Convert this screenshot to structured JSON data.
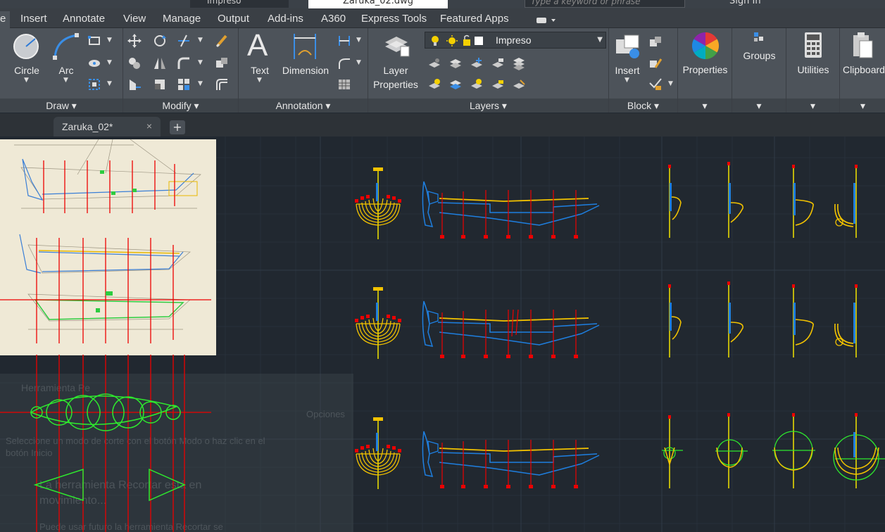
{
  "titlebar": {
    "layer_name": "Impreso",
    "document_title": "Zaruka_02.dwg",
    "search_placeholder": "Type a keyword or phrase",
    "sign_in": "Sign In"
  },
  "ribbon_tabs": [
    "e",
    "Insert",
    "Annotate",
    "View",
    "Manage",
    "Output",
    "Add-ins",
    "A360",
    "Express Tools",
    "Featured Apps"
  ],
  "ribbon": {
    "draw": {
      "circle": "Circle",
      "arc": "Arc",
      "title": "Draw"
    },
    "modify": {
      "title": "Modify"
    },
    "annotation": {
      "text": "Text",
      "dimension": "Dimension",
      "title": "Annotation"
    },
    "layers": {
      "layer_properties_line1": "Layer",
      "layer_properties_line2": "Properties",
      "current_layer": "Impreso",
      "title": "Layers"
    },
    "block": {
      "insert": "Insert",
      "title": "Block"
    },
    "properties": {
      "label": "Properties"
    },
    "groups": {
      "label": "Groups"
    },
    "utilities": {
      "label": "Utilities"
    },
    "clipboard": {
      "label": "Clipboard"
    }
  },
  "file_tabs": [
    {
      "label": "Zaruka_02*",
      "close": "×"
    }
  ],
  "new_tab_symbol": "+",
  "colors": {
    "yellow": "#f2c200",
    "blue": "#1e7fe0",
    "red": "#ff1a1a",
    "green": "#2ee82e",
    "canvas": "#212830"
  }
}
